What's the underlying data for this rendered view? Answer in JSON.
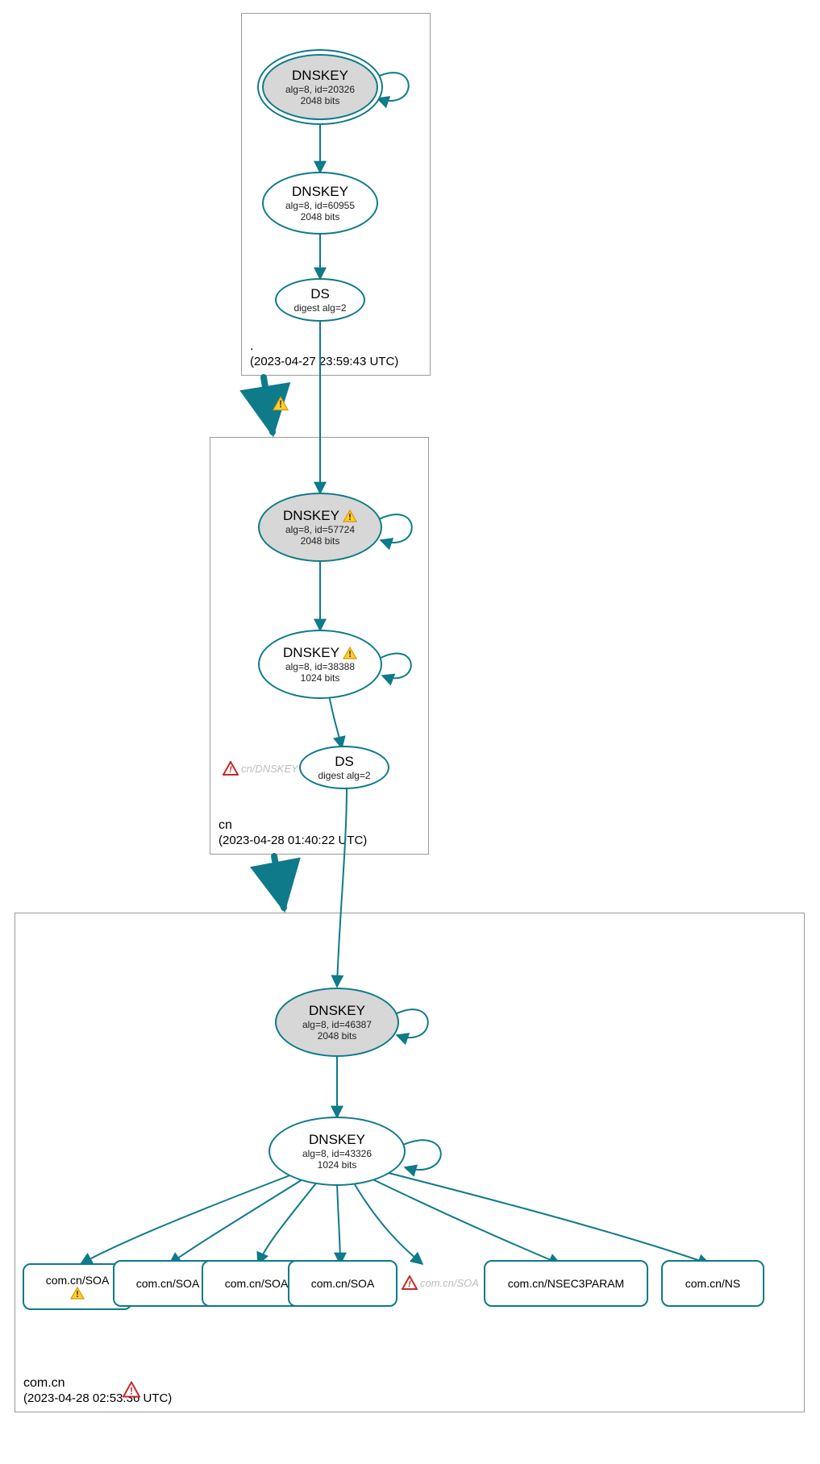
{
  "colors": {
    "teal": "#0e7a8a",
    "nodeFill": "#d7d7d7"
  },
  "zones": {
    "root": {
      "name": ".",
      "timestamp": "(2023-04-27 23:59:43 UTC)"
    },
    "cn": {
      "name": "cn",
      "timestamp": "(2023-04-28 01:40:22 UTC)"
    },
    "comcn": {
      "name": "com.cn",
      "timestamp": "(2023-04-28 02:53:36 UTC)"
    }
  },
  "nodes": {
    "root_ksk": {
      "title": "DNSKEY",
      "line2": "alg=8, id=20326",
      "line3": "2048 bits"
    },
    "root_zsk": {
      "title": "DNSKEY",
      "line2": "alg=8, id=60955",
      "line3": "2048 bits"
    },
    "root_ds": {
      "title": "DS",
      "line2": "digest alg=2"
    },
    "cn_ksk": {
      "title": "DNSKEY",
      "line2": "alg=8, id=57724",
      "line3": "2048 bits"
    },
    "cn_zsk": {
      "title": "DNSKEY",
      "line2": "alg=8, id=38388",
      "line3": "1024 bits"
    },
    "cn_ds": {
      "title": "DS",
      "line2": "digest alg=2"
    },
    "comcn_ksk": {
      "title": "DNSKEY",
      "line2": "alg=8, id=46387",
      "line3": "2048 bits"
    },
    "comcn_zsk": {
      "title": "DNSKEY",
      "line2": "alg=8, id=43326",
      "line3": "1024 bits"
    },
    "rr1": {
      "title": "com.cn/SOA"
    },
    "rr2": {
      "title": "com.cn/SOA"
    },
    "rr3": {
      "title": "com.cn/SOA"
    },
    "rr4": {
      "title": "com.cn/SOA"
    },
    "rr6": {
      "title": "com.cn/NSEC3PARAM"
    },
    "rr7": {
      "title": "com.cn/NS"
    }
  },
  "ghosts": {
    "cn_dnskey": "cn/DNSKEY",
    "comcn_soa": "com.cn/SOA"
  }
}
